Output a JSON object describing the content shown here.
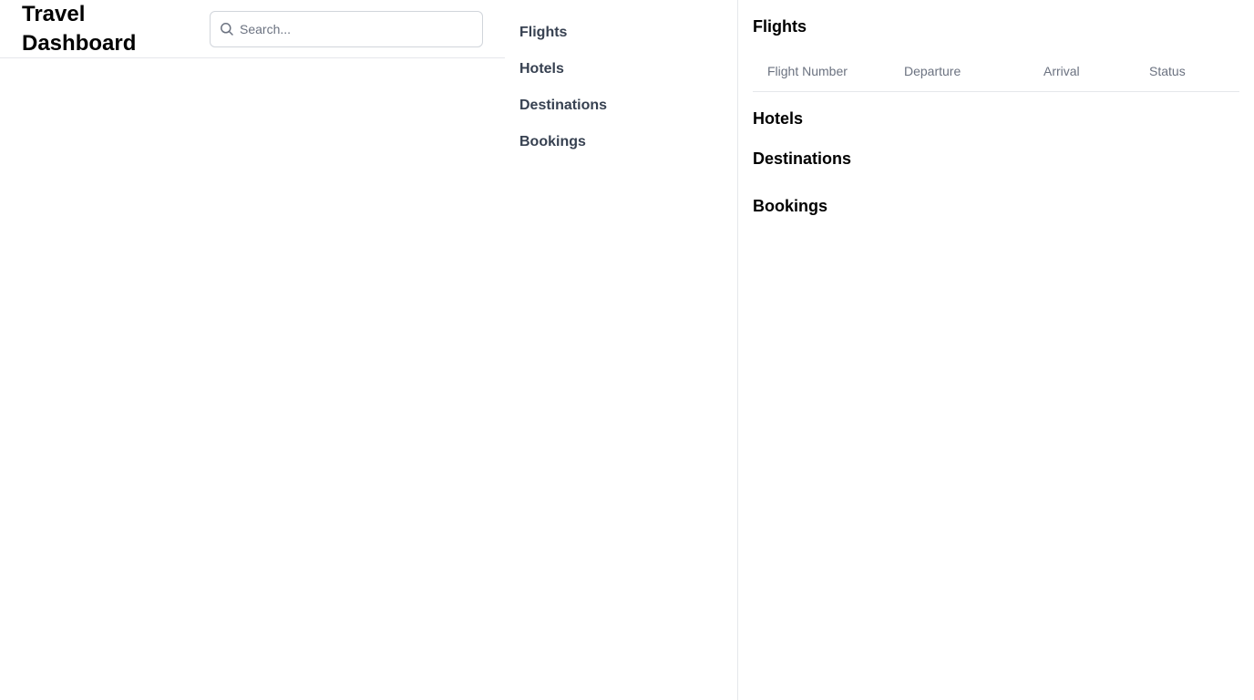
{
  "app": {
    "title": "Travel Dashboard"
  },
  "search": {
    "placeholder": "Search...",
    "value": "",
    "icon": "search-icon"
  },
  "nav": {
    "items": [
      {
        "label": "Flights"
      },
      {
        "label": "Hotels"
      },
      {
        "label": "Destinations"
      },
      {
        "label": "Bookings"
      }
    ]
  },
  "main": {
    "flights": {
      "title": "Flights",
      "columns": [
        "Flight Number",
        "Departure",
        "Arrival",
        "Status"
      ]
    },
    "hotels": {
      "title": "Hotels"
    },
    "destinations": {
      "title": "Destinations"
    },
    "bookings": {
      "title": "Bookings"
    }
  },
  "colors": {
    "border": "#e5e7eb",
    "nav_text": "#374151",
    "header_text": "#6b7280"
  }
}
